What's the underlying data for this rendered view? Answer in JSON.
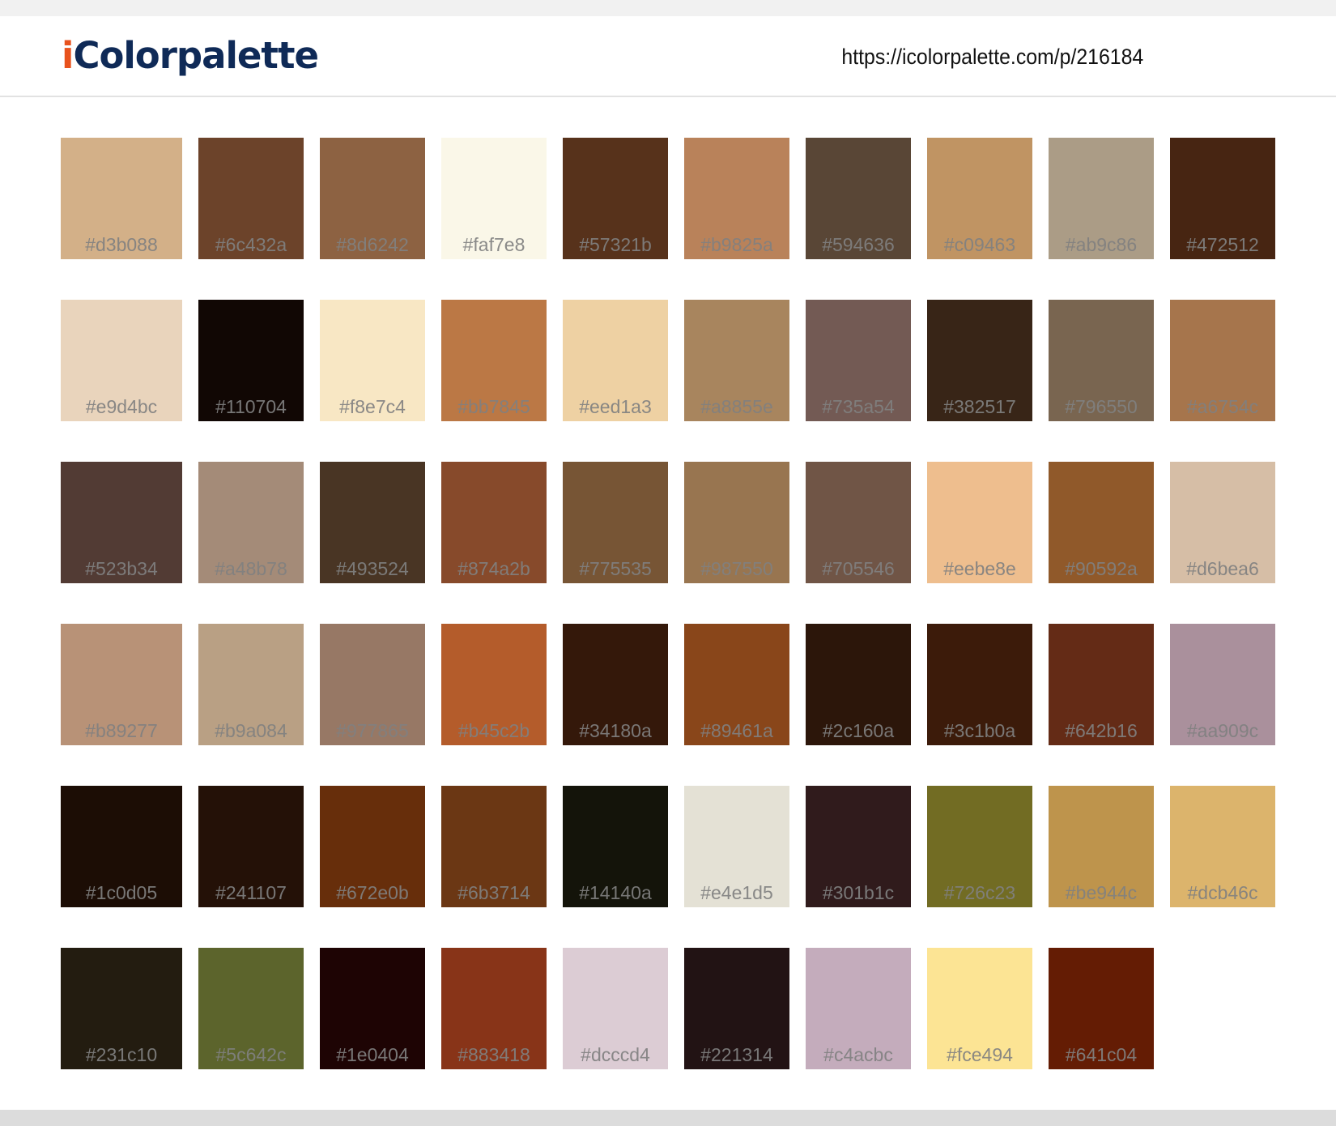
{
  "header": {
    "logo_accent": "i",
    "logo_rest": "Colorpalette",
    "url": "https://icolorpalette.com/p/216184"
  },
  "palette": {
    "rows": [
      [
        "#d3b088",
        "#6c432a",
        "#8d6242",
        "#faf7e8",
        "#57321b",
        "#b9825a",
        "#594636",
        "#c09463",
        "#ab9c86",
        "#472512"
      ],
      [
        "#e9d4bc",
        "#110704",
        "#f8e7c4",
        "#bb7845",
        "#eed1a3",
        "#a8855e",
        "#735a54",
        "#382517",
        "#796550",
        "#a6754c"
      ],
      [
        "#523b34",
        "#a48b78",
        "#493524",
        "#874a2b",
        "#775535",
        "#987550",
        "#705546",
        "#eebe8e",
        "#90592a",
        "#d6bea6"
      ],
      [
        "#b89277",
        "#b9a084",
        "#977865",
        "#b45c2b",
        "#34180a",
        "#89461a",
        "#2c160a",
        "#3c1b0a",
        "#642b16",
        "#aa909c"
      ],
      [
        "#1c0d05",
        "#241107",
        "#672e0b",
        "#6b3714",
        "#14140a",
        "#e4e1d5",
        "#301b1c",
        "#726c23",
        "#be944c",
        "#dcb46c"
      ],
      [
        "#231c10",
        "#5c642c",
        "#1e0404",
        "#883418",
        "#dcccd4",
        "#221314",
        "#c4acbc",
        "#fce494",
        "#641c04"
      ]
    ]
  }
}
